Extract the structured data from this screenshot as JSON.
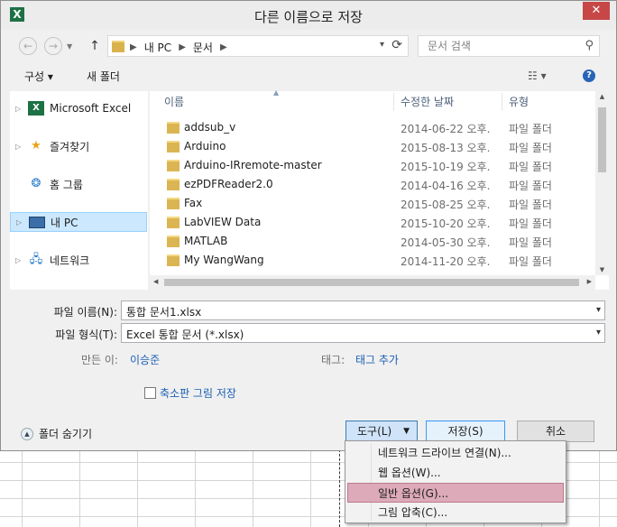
{
  "window": {
    "title": "다른 이름으로 저장",
    "app_icon": "X",
    "close_glyph": "✕"
  },
  "nav": {
    "back_glyph": "←",
    "forward_glyph": "→",
    "up_glyph": "↑",
    "breadcrumb": [
      "내 PC",
      "문서"
    ],
    "search_placeholder": "문서 검색"
  },
  "toolbar": {
    "organize_label": "구성 ▾",
    "new_folder_label": "새 폴더",
    "help_glyph": "?"
  },
  "sidebar": {
    "items": [
      {
        "label": "Microsoft Excel",
        "icon": "excel-icon"
      },
      {
        "label": "즐겨찾기",
        "icon": "star-icon"
      },
      {
        "label": "홈 그룹",
        "icon": "homegroup-icon"
      },
      {
        "label": "내 PC",
        "icon": "computer-icon",
        "selected": true
      },
      {
        "label": "네트워크",
        "icon": "network-icon"
      }
    ]
  },
  "files": {
    "columns": [
      "이름",
      "수정한 날짜",
      "유형"
    ],
    "rows": [
      {
        "name": "addsub_v",
        "date": "2014-06-22 오후...",
        "type": "파일 폴더"
      },
      {
        "name": "Arduino",
        "date": "2015-08-13 오후...",
        "type": "파일 폴더"
      },
      {
        "name": "Arduino-IRremote-master",
        "date": "2015-10-19 오후...",
        "type": "파일 폴더"
      },
      {
        "name": "ezPDFReader2.0",
        "date": "2014-04-16 오후...",
        "type": "파일 폴더"
      },
      {
        "name": "Fax",
        "date": "2015-08-25 오후...",
        "type": "파일 폴더"
      },
      {
        "name": "LabVIEW Data",
        "date": "2015-10-20 오후...",
        "type": "파일 폴더"
      },
      {
        "name": "MATLAB",
        "date": "2014-05-30 오후...",
        "type": "파일 폴더"
      },
      {
        "name": "My WangWang",
        "date": "2014-11-20 오후...",
        "type": "파일 폴더"
      },
      {
        "name": "",
        "date": "",
        "type": "파일 폴더"
      }
    ]
  },
  "form": {
    "filename_label": "파일 이름(N):",
    "filename_value": "통합 문서1.xlsx",
    "filetype_label": "파일 형식(T):",
    "filetype_value": "Excel 통합 문서 (*.xlsx)",
    "author_label": "만든 이:",
    "author_value": "이승준",
    "tags_label": "태그:",
    "tags_value": "태그 추가",
    "thumbnail_label": "축소판 그림 저장"
  },
  "footer": {
    "hide_folders_label": "폴더 숨기기",
    "tools_label": "도구(L)",
    "save_label": "저장(S)",
    "cancel_label": "취소"
  },
  "tools_menu": {
    "items": [
      {
        "label": "네트워크 드라이브 연결(N)..."
      },
      {
        "label": "웹 옵션(W)..."
      },
      {
        "label": "일반 옵션(G)...",
        "highlighted": true
      },
      {
        "label": "그림 압축(C)..."
      }
    ]
  }
}
